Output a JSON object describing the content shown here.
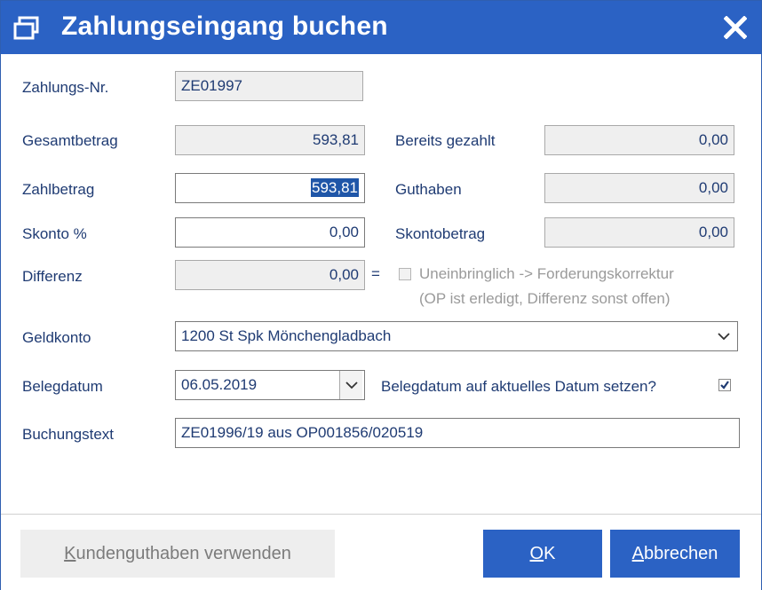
{
  "window": {
    "title": "Zahlungseingang buchen",
    "accent_color": "#2b62c4",
    "title_icon": "restore-window-icon",
    "close_icon": "close-icon"
  },
  "form": {
    "zahlungs_nr": {
      "label": "Zahlungs-Nr.",
      "value": "ZE01997"
    },
    "gesamtbetrag": {
      "label": "Gesamtbetrag",
      "value": "593,81"
    },
    "bereits_gezahlt": {
      "label": "Bereits gezahlt",
      "value": "0,00"
    },
    "zahlbetrag": {
      "label": "Zahlbetrag",
      "value": "593,81"
    },
    "guthaben": {
      "label": "Guthaben",
      "value": "0,00"
    },
    "skonto_pct": {
      "label": "Skonto %",
      "value": "0,00"
    },
    "skontobetrag": {
      "label": "Skontobetrag",
      "value": "0,00"
    },
    "differenz": {
      "label": "Differenz",
      "value": "0,00",
      "equals": "="
    },
    "uneinbringlich": {
      "label": "Uneinbringlich -> Forderungskorrektur",
      "hint": "(OP ist erledigt, Differenz sonst offen)",
      "checked": false
    },
    "geldkonto": {
      "label": "Geldkonto",
      "value": "1200 St Spk Mönchengladbach"
    },
    "belegdatum": {
      "label": "Belegdatum",
      "value": "06.05.2019"
    },
    "belegdatum_aktuell": {
      "label": "Belegdatum auf aktuelles Datum setzen?",
      "checked": true
    },
    "buchungstext": {
      "label": "Buchungstext",
      "value": "ZE01996/19 aus OP001856/020519"
    }
  },
  "footer": {
    "kundenguthaben": {
      "prefix": "K",
      "rest": "undenguthaben verwenden"
    },
    "ok": {
      "prefix": "O",
      "rest": "K"
    },
    "abbrechen": {
      "prefix": "A",
      "rest": "bbrechen"
    }
  }
}
